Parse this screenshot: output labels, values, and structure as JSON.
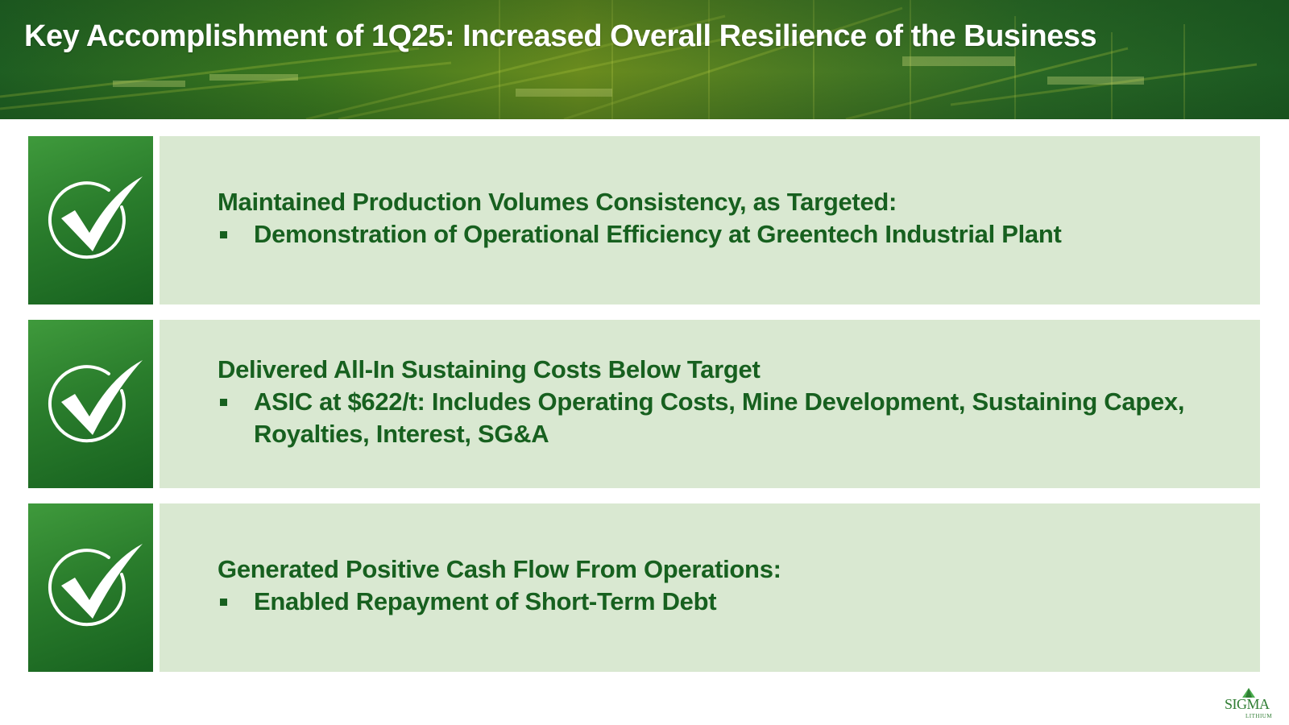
{
  "header": {
    "title": "Key Accomplishment of 1Q25: Increased Overall Resilience of the Business"
  },
  "accomplishments": [
    {
      "icon": "checkmark-icon",
      "heading": "Maintained Production Volumes Consistency, as Targeted:",
      "bullet": "Demonstration of Operational Efficiency at Greentech Industrial Plant"
    },
    {
      "icon": "checkmark-icon",
      "heading": "Delivered All-In Sustaining Costs Below Target",
      "bullet": "ASIC at $622/t: Includes Operating Costs, Mine Development, Sustaining Capex, Royalties, Interest, SG&A"
    },
    {
      "icon": "checkmark-icon",
      "heading": "Generated Positive Cash Flow From Operations:",
      "bullet": "Enabled Repayment of Short-Term Debt"
    }
  ],
  "logo": {
    "wordmark": "SIGMA",
    "subtext": "LITHIUM"
  },
  "colors": {
    "primary_green": "#17601f",
    "panel_bg": "#d9e8d1",
    "tile_green": "#2a7d2c",
    "title_text": "#ffffff"
  }
}
